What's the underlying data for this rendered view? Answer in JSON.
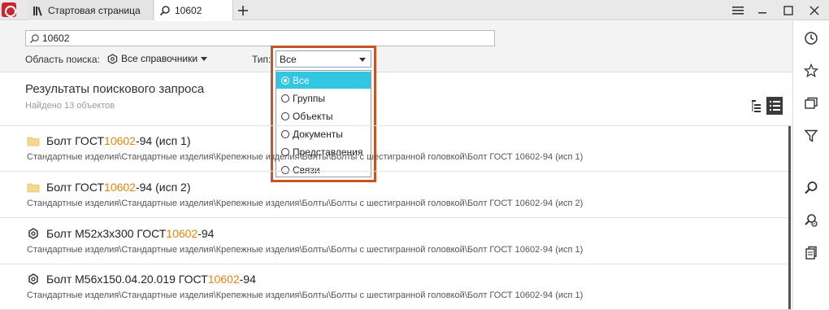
{
  "tabs": [
    {
      "label": "Стартовая страница",
      "icon": "library-icon"
    },
    {
      "label": "10602",
      "icon": "search-icon"
    }
  ],
  "search": {
    "value": "10602",
    "scope_label": "Область поиска:",
    "scope_value": "Все справочники",
    "type_label": "Тип:",
    "type_value": "Все",
    "type_options": [
      "Все",
      "Группы",
      "Объекты",
      "Документы",
      "Представления",
      "Связи"
    ],
    "type_selected_index": 0
  },
  "results": {
    "title": "Результаты поискового запроса",
    "count": "Найдено 13 объектов",
    "items": [
      {
        "icon": "folder-icon",
        "pre": "Болт ГОСТ ",
        "hl": "10602",
        "post": "-94 (исп 1)",
        "path": "Стандартные изделия\\Стандартные изделия\\Крепежные изделия\\Болты\\Болты с шестигранной головкой\\Болт ГОСТ 10602-94 (исп 1)"
      },
      {
        "icon": "folder-icon",
        "pre": "Болт ГОСТ ",
        "hl": "10602",
        "post": "-94 (исп 2)",
        "path": "Стандартные изделия\\Стандартные изделия\\Крепежные изделия\\Болты\\Болты с шестигранной головкой\\Болт ГОСТ 10602-94 (исп 2)"
      },
      {
        "icon": "object-icon",
        "pre": "Болт М52x3x300 ГОСТ ",
        "hl": "10602",
        "post": "-94",
        "path": "Стандартные изделия\\Стандартные изделия\\Крепежные изделия\\Болты\\Болты с шестигранной головкой\\Болт ГОСТ 10602-94 (исп 1)"
      },
      {
        "icon": "object-icon",
        "pre": "Болт М56x150.04.20.019 ГОСТ ",
        "hl": "10602",
        "post": "-94",
        "path": "Стандартные изделия\\Стандартные изделия\\Крепежные изделия\\Болты\\Болты с шестигранной головкой\\Болт ГОСТ 10602-94 (исп 1)"
      }
    ]
  },
  "sidebar": [
    "history-icon",
    "favorites-star-icon",
    "collections-icon",
    "filter-icon",
    "search-icon",
    "advanced-search-icon",
    "documents-icon"
  ],
  "colors": {
    "accent": "#33c6e2",
    "highlight": "#e8840c",
    "focus_frame": "#c55526",
    "logo": "#c8282b"
  }
}
